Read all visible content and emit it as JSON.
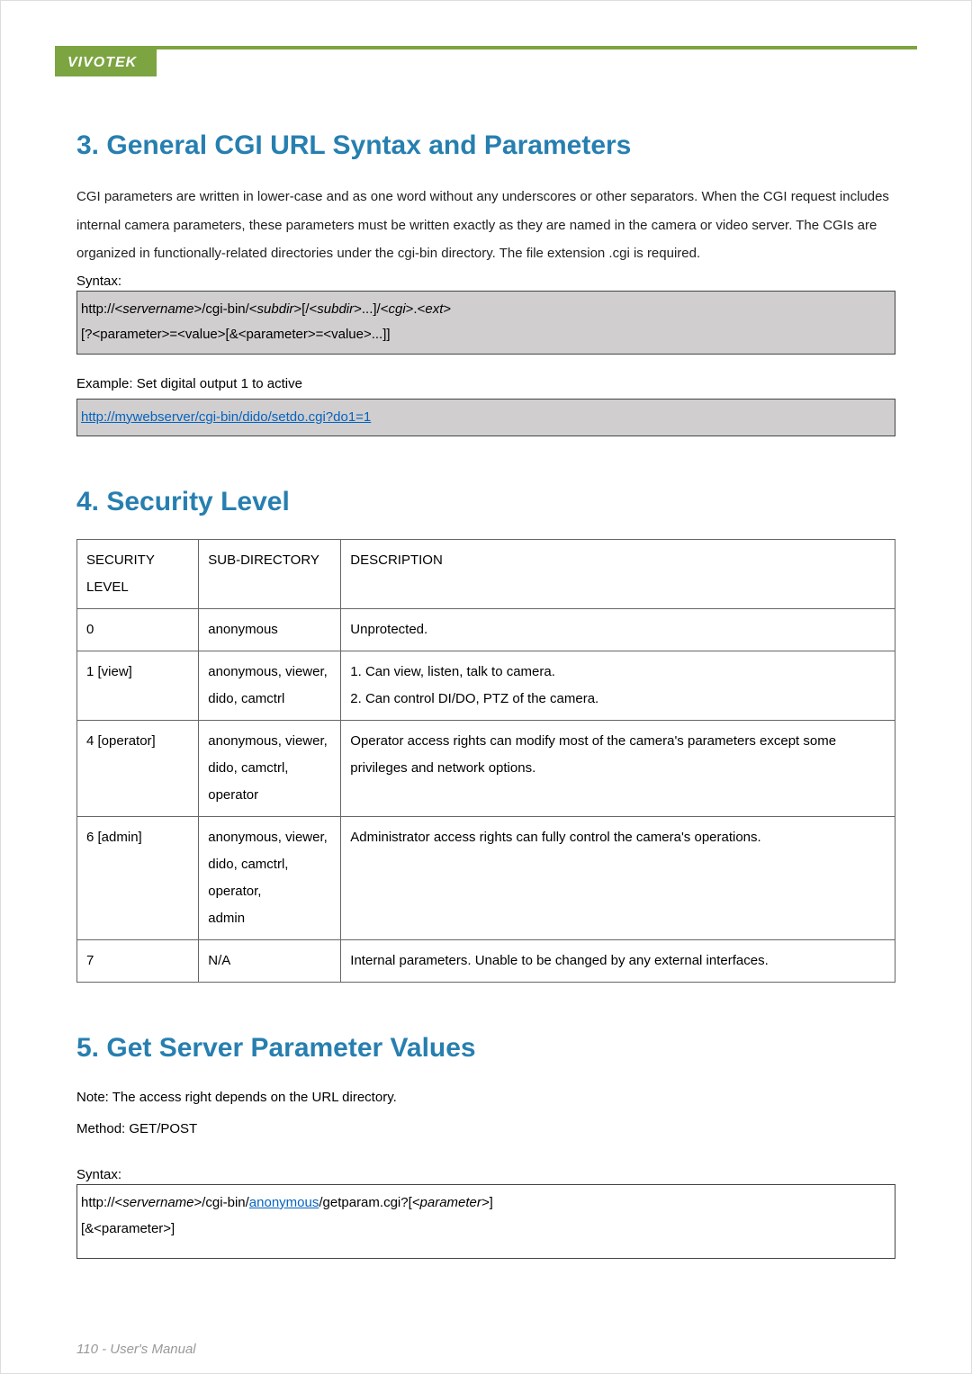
{
  "brand": "VIVOTEK",
  "section3": {
    "heading": "3. General CGI URL Syntax and Parameters",
    "paragraph": "CGI parameters are written in lower-case and as one word without any underscores or other separators. When the CGI request includes internal camera parameters, these parameters must be written exactly as they are named in the camera or video server. The CGIs are organized in functionally-related directories under the cgi-bin directory. The file extension .cgi is required.",
    "syntax_label": "Syntax:",
    "code_line1_plain1": "http://<",
    "code_line1_em1": "servername",
    "code_line1_plain2": ">/cgi-bin/<",
    "code_line1_em2": "subdir",
    "code_line1_plain3": ">[/<",
    "code_line1_em3": "subdir",
    "code_line1_plain4": ">...]/<",
    "code_line1_em4": "cgi",
    "code_line1_plain5": ">.<",
    "code_line1_em5": "ext",
    "code_line1_plain6": ">",
    "code_line2": "[?<parameter>=<value>[&<parameter>=<value>...]]",
    "example_label": "Example:    Set digital output 1 to active",
    "example_link": "http://mywebserver/cgi-bin/dido/setdo.cgi?do1=1"
  },
  "section4": {
    "heading": "4. Security Level",
    "table": {
      "headers": [
        "SECURITY LEVEL",
        "SUB-DIRECTORY",
        "DESCRIPTION"
      ],
      "rows": [
        {
          "level": "0",
          "subdir": "anonymous",
          "desc": "Unprotected."
        },
        {
          "level": "1 [view]",
          "subdir": "anonymous, viewer,\ndido, camctrl",
          "desc": "1. Can view, listen, talk to camera.\n2. Can control DI/DO, PTZ of the camera."
        },
        {
          "level": "4 [operator]",
          "subdir": "anonymous, viewer,\ndido, camctrl, operator",
          "desc": "Operator access rights can modify most of the camera's parameters except some privileges and network options."
        },
        {
          "level": "6 [admin]",
          "subdir": "anonymous, viewer,\ndido, camctrl, operator,\nadmin",
          "desc": "Administrator access rights can fully control the camera's operations."
        },
        {
          "level": "7",
          "subdir": "N/A",
          "desc": "Internal parameters. Unable to be changed by any external interfaces."
        }
      ]
    }
  },
  "section5": {
    "heading": "5. Get Server Parameter Values",
    "note": "Note:    The access right depends on the URL directory.",
    "method": "Method:    GET/POST",
    "syntax_label": "Syntax:",
    "box_line1_p1": "http://<",
    "box_line1_em1": "servername",
    "box_line1_p2": ">/cgi-bin/",
    "box_link1": "anonymous",
    "box_line1_p3": "/getparam.cgi?[",
    "box_line1_em2": "<parameter>",
    "box_line1_p4": "]",
    "box_line2": "[&<parameter>]"
  },
  "footer": "110 - User's Manual"
}
